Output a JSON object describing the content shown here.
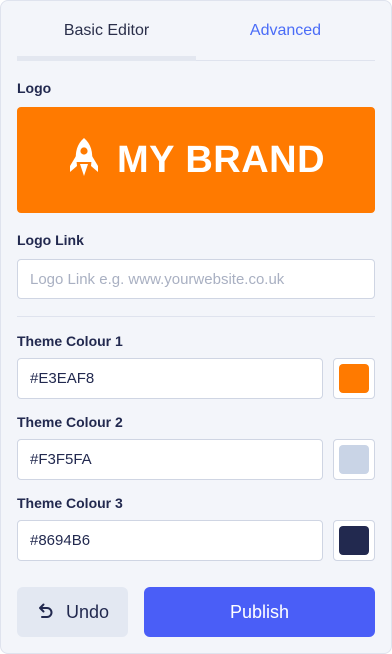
{
  "tabs": [
    {
      "label": "Basic Editor",
      "active": true
    },
    {
      "label": "Advanced",
      "active": false
    }
  ],
  "logo": {
    "label": "Logo",
    "text": "MY BRAND",
    "icon": "rocket-icon",
    "background": "#FF7A00"
  },
  "logo_link": {
    "label": "Logo Link",
    "value": "",
    "placeholder": "Logo Link e.g. www.yourwebsite.co.uk"
  },
  "theme_colours": [
    {
      "label": "Theme Colour 1",
      "value": "#E3EAF8",
      "swatch": "#FF7A00"
    },
    {
      "label": "Theme Colour 2",
      "value": "#F3F5FA",
      "swatch": "#C9D4E6"
    },
    {
      "label": "Theme Colour 3",
      "value": "#8694B6",
      "swatch": "#22294F"
    }
  ],
  "actions": {
    "undo_label": "Undo",
    "undo_icon": "undo-icon",
    "publish_label": "Publish"
  },
  "colors": {
    "accent": "#4A5EF7",
    "tab_link": "#4A6CF7",
    "text": "#22294F",
    "panel_bg": "#F3F5FA"
  }
}
